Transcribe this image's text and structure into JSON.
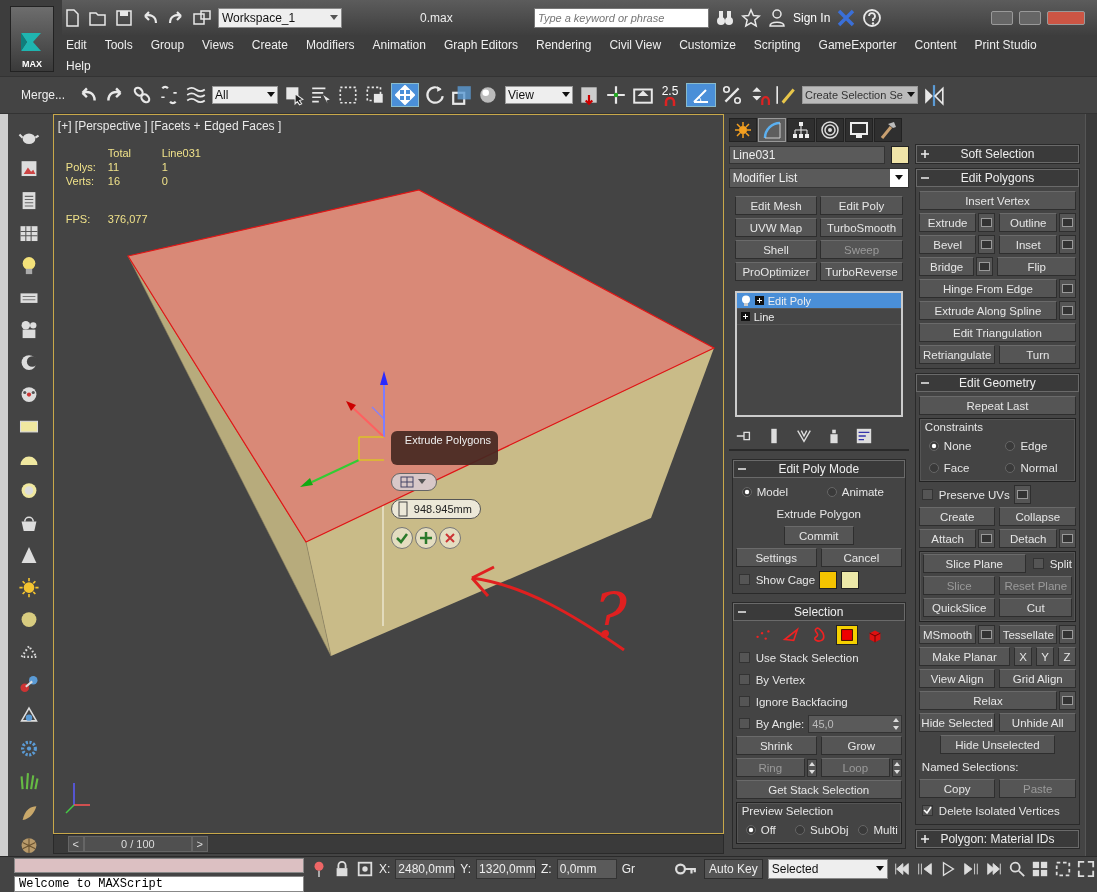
{
  "title_bar": {
    "logo": "MAX",
    "workspace": "Workspace_1",
    "file_title": "0.max",
    "search": {
      "placeholder": "Type a keyword or phrase"
    },
    "sign_in": "Sign In"
  },
  "menu_rows": [
    [
      "Edit",
      "Tools",
      "Group",
      "Views",
      "Create",
      "Modifiers",
      "Animation",
      "Graph Editors",
      "Rendering",
      "Civil View",
      "Customize",
      "Scripting",
      "GameExporter",
      "Content",
      "Print Studio"
    ],
    [
      "Help"
    ]
  ],
  "main_toolbar": {
    "merge": "Merge...",
    "selection_filter": "All",
    "reference_coordinates": "View",
    "snap_value": "2.5",
    "selection_set": "Create Selection Se"
  },
  "viewport": {
    "label": "[+] [Perspective ] [Facets + Edged Faces ]",
    "stats": {
      "columns": [
        "Total",
        "Line031"
      ],
      "rows": [
        {
          "label": "Polys:",
          "total": "11",
          "selected_object": "1"
        },
        {
          "label": "Verts:",
          "total": "16",
          "selected_object": "0"
        }
      ],
      "fps_label": "FPS:",
      "fps": "376,077"
    },
    "caddy": {
      "title": "Extrude Polygons",
      "value": "948.945mm"
    },
    "annotation": "?"
  },
  "command_panel": {
    "tabs": [
      {
        "selected": false
      },
      {
        "selected": true
      },
      {
        "selected": false
      },
      {
        "selected": false
      },
      {
        "selected": false
      },
      {
        "selected": false
      }
    ],
    "object_name": "Line031",
    "modifier_list": "Modifier List",
    "modifier_buttons": [
      {
        "label": "Edit Mesh",
        "disabled": false
      },
      {
        "label": "Edit Poly",
        "disabled": false
      },
      {
        "label": "UVW Map",
        "disabled": false
      },
      {
        "label": "TurboSmooth",
        "disabled": false
      },
      {
        "label": "Shell",
        "disabled": false
      },
      {
        "label": "Sweep",
        "disabled": true
      },
      {
        "label": "ProOptimizer",
        "disabled": false
      },
      {
        "label": "TurboReverse",
        "disabled": false
      }
    ],
    "stack": [
      {
        "label": "Edit Poly",
        "selected": true
      },
      {
        "label": "Line",
        "selected": false
      }
    ],
    "rollouts": [
      {
        "title": "Edit Poly Mode",
        "expanded": true,
        "rows": [
          [
            {
              "kind": "radio",
              "label": "Model",
              "selected": true
            },
            {
              "kind": "radio",
              "label": "Animate",
              "selected": false
            }
          ],
          [
            {
              "kind": "caption",
              "text": "Extrude Polygon"
            }
          ],
          [
            {
              "kind": "narrow_button",
              "label": "Commit",
              "disabled": false
            }
          ],
          [
            {
              "kind": "button",
              "label": "Settings",
              "disabled": false
            },
            {
              "kind": "button",
              "label": "Cancel",
              "disabled": false
            }
          ],
          [
            {
              "kind": "checkbox",
              "label": "Show Cage",
              "checked": false
            },
            {
              "kind": "swatch",
              "color": "#f5c400"
            },
            {
              "kind": "swatch",
              "color": "#ece8a8"
            }
          ]
        ]
      },
      {
        "title": "Selection",
        "expanded": true,
        "rows": [
          [
            {
              "kind": "subobject",
              "selected": false
            },
            {
              "kind": "subobject",
              "selected": false
            },
            {
              "kind": "subobject",
              "selected": false
            },
            {
              "kind": "subobject",
              "selected": true
            },
            {
              "kind": "subobject",
              "selected": false
            }
          ],
          [
            {
              "kind": "checkbox",
              "label": "Use Stack Selection",
              "checked": false
            }
          ],
          [
            {
              "kind": "checkbox",
              "label": "By Vertex",
              "checked": false
            }
          ],
          [
            {
              "kind": "checkbox",
              "label": "Ignore Backfacing",
              "checked": false
            }
          ],
          [
            {
              "kind": "checkbox",
              "label": "By Angle:",
              "checked": false
            },
            {
              "kind": "spinner",
              "value": "45,0"
            }
          ],
          [
            {
              "kind": "button",
              "label": "Shrink",
              "disabled": false
            },
            {
              "kind": "button",
              "label": "Grow",
              "disabled": false
            }
          ],
          [
            {
              "kind": "spin_button",
              "label": "Ring",
              "disabled": true
            },
            {
              "kind": "spin_button",
              "label": "Loop",
              "disabled": true
            }
          ],
          [
            {
              "kind": "button",
              "label": "Get Stack Selection",
              "disabled": false
            }
          ],
          [
            {
              "kind": "group",
              "title": "Preview Selection",
              "rows": [
                [
                  {
                    "kind": "radio",
                    "label": "Off",
                    "selected": true
                  },
                  {
                    "kind": "radio",
                    "label": "SubObj",
                    "selected": false
                  },
                  {
                    "kind": "radio",
                    "label": "Multi",
                    "selected": false
                  }
                ]
              ]
            }
          ]
        ]
      }
    ]
  },
  "right_rollouts": [
    {
      "title": "Soft Selection",
      "expanded": false
    },
    {
      "title": "Edit Polygons",
      "expanded": true,
      "rows": [
        [
          {
            "kind": "button",
            "label": "Insert Vertex",
            "disabled": false
          }
        ],
        [
          {
            "kind": "settings_button",
            "label": "Extrude",
            "disabled": false
          },
          {
            "kind": "settings_button",
            "label": "Outline",
            "disabled": false
          }
        ],
        [
          {
            "kind": "settings_button",
            "label": "Bevel",
            "disabled": false
          },
          {
            "kind": "settings_button",
            "label": "Inset",
            "disabled": false
          }
        ],
        [
          {
            "kind": "settings_button",
            "label": "Bridge",
            "disabled": false
          },
          {
            "kind": "button",
            "label": "Flip",
            "disabled": false
          }
        ],
        [
          {
            "kind": "settings_button",
            "label": "Hinge From Edge",
            "disabled": false
          }
        ],
        [
          {
            "kind": "settings_button",
            "label": "Extrude Along Spline",
            "disabled": false
          }
        ],
        [
          {
            "kind": "button",
            "label": "Edit Triangulation",
            "disabled": false
          }
        ],
        [
          {
            "kind": "button",
            "label": "Retriangulate",
            "disabled": false
          },
          {
            "kind": "button",
            "label": "Turn",
            "disabled": false
          }
        ]
      ]
    },
    {
      "title": "Edit Geometry",
      "expanded": true,
      "rows": [
        [
          {
            "kind": "button",
            "label": "Repeat Last",
            "disabled": false
          }
        ],
        [
          {
            "kind": "group",
            "title": "Constraints",
            "rows": [
              [
                {
                  "kind": "radio",
                  "label": "None",
                  "selected": true
                },
                {
                  "kind": "radio",
                  "label": "Edge",
                  "selected": false
                }
              ],
              [
                {
                  "kind": "radio",
                  "label": "Face",
                  "selected": false
                },
                {
                  "kind": "radio",
                  "label": "Normal",
                  "selected": false
                }
              ]
            ]
          }
        ],
        [
          {
            "kind": "checkbox",
            "label": "Preserve UVs",
            "checked": false
          },
          {
            "kind": "settings_box"
          }
        ],
        [
          {
            "kind": "button",
            "label": "Create",
            "disabled": false
          },
          {
            "kind": "button",
            "label": "Collapse",
            "disabled": false
          }
        ],
        [
          {
            "kind": "settings_button",
            "label": "Attach",
            "disabled": false
          },
          {
            "kind": "settings_button",
            "label": "Detach",
            "disabled": false
          }
        ],
        [
          {
            "kind": "group",
            "rows": [
              [
                {
                  "kind": "button",
                  "label": "Slice Plane",
                  "disabled": false
                },
                {
                  "kind": "checkbox",
                  "label": "Split",
                  "checked": false
                }
              ],
              [
                {
                  "kind": "button",
                  "label": "Slice",
                  "disabled": true
                },
                {
                  "kind": "button",
                  "label": "Reset Plane",
                  "disabled": true
                }
              ],
              [
                {
                  "kind": "button",
                  "label": "QuickSlice",
                  "disabled": false
                },
                {
                  "kind": "button",
                  "label": "Cut",
                  "disabled": false
                }
              ]
            ]
          }
        ],
        [
          {
            "kind": "settings_button",
            "label": "MSmooth",
            "disabled": false
          },
          {
            "kind": "settings_button",
            "label": "Tessellate",
            "disabled": false
          }
        ],
        [
          {
            "kind": "button",
            "label": "Make Planar",
            "disabled": false
          },
          {
            "kind": "small_button",
            "label": "X",
            "disabled": false
          },
          {
            "kind": "small_button",
            "label": "Y",
            "disabled": false
          },
          {
            "kind": "small_button",
            "label": "Z",
            "disabled": false
          }
        ],
        [
          {
            "kind": "button",
            "label": "View Align",
            "disabled": false
          },
          {
            "kind": "button",
            "label": "Grid Align",
            "disabled": false
          }
        ],
        [
          {
            "kind": "settings_button",
            "label": "Relax",
            "disabled": false
          }
        ],
        [
          {
            "kind": "button",
            "label": "Hide Selected",
            "disabled": false
          },
          {
            "kind": "button",
            "label": "Unhide All",
            "disabled": false
          }
        ],
        [
          {
            "kind": "narrow_button",
            "label": "Hide Unselected",
            "disabled": false
          }
        ],
        [
          {
            "kind": "label",
            "text": "Named Selections:"
          }
        ],
        [
          {
            "kind": "button",
            "label": "Copy",
            "disabled": false
          },
          {
            "kind": "button",
            "label": "Paste",
            "disabled": true
          }
        ],
        [
          {
            "kind": "checkbox",
            "label": "Delete Isolated Vertices",
            "checked": true
          }
        ]
      ]
    },
    {
      "title": "Polygon: Material IDs",
      "expanded": false
    }
  ],
  "time_slider": {
    "prev": "<",
    "frame": "0 / 100",
    "next": ">"
  },
  "status_bar": {
    "listener": "Welcome to MAXScript",
    "x_label": "X:",
    "x": "2480,0mm",
    "y_label": "Y:",
    "y": "1320,0mm",
    "z_label": "Z:",
    "z": "0,0mm",
    "grid_label": "Gr",
    "auto_key": "Auto Key",
    "key_mode": "Selected"
  }
}
